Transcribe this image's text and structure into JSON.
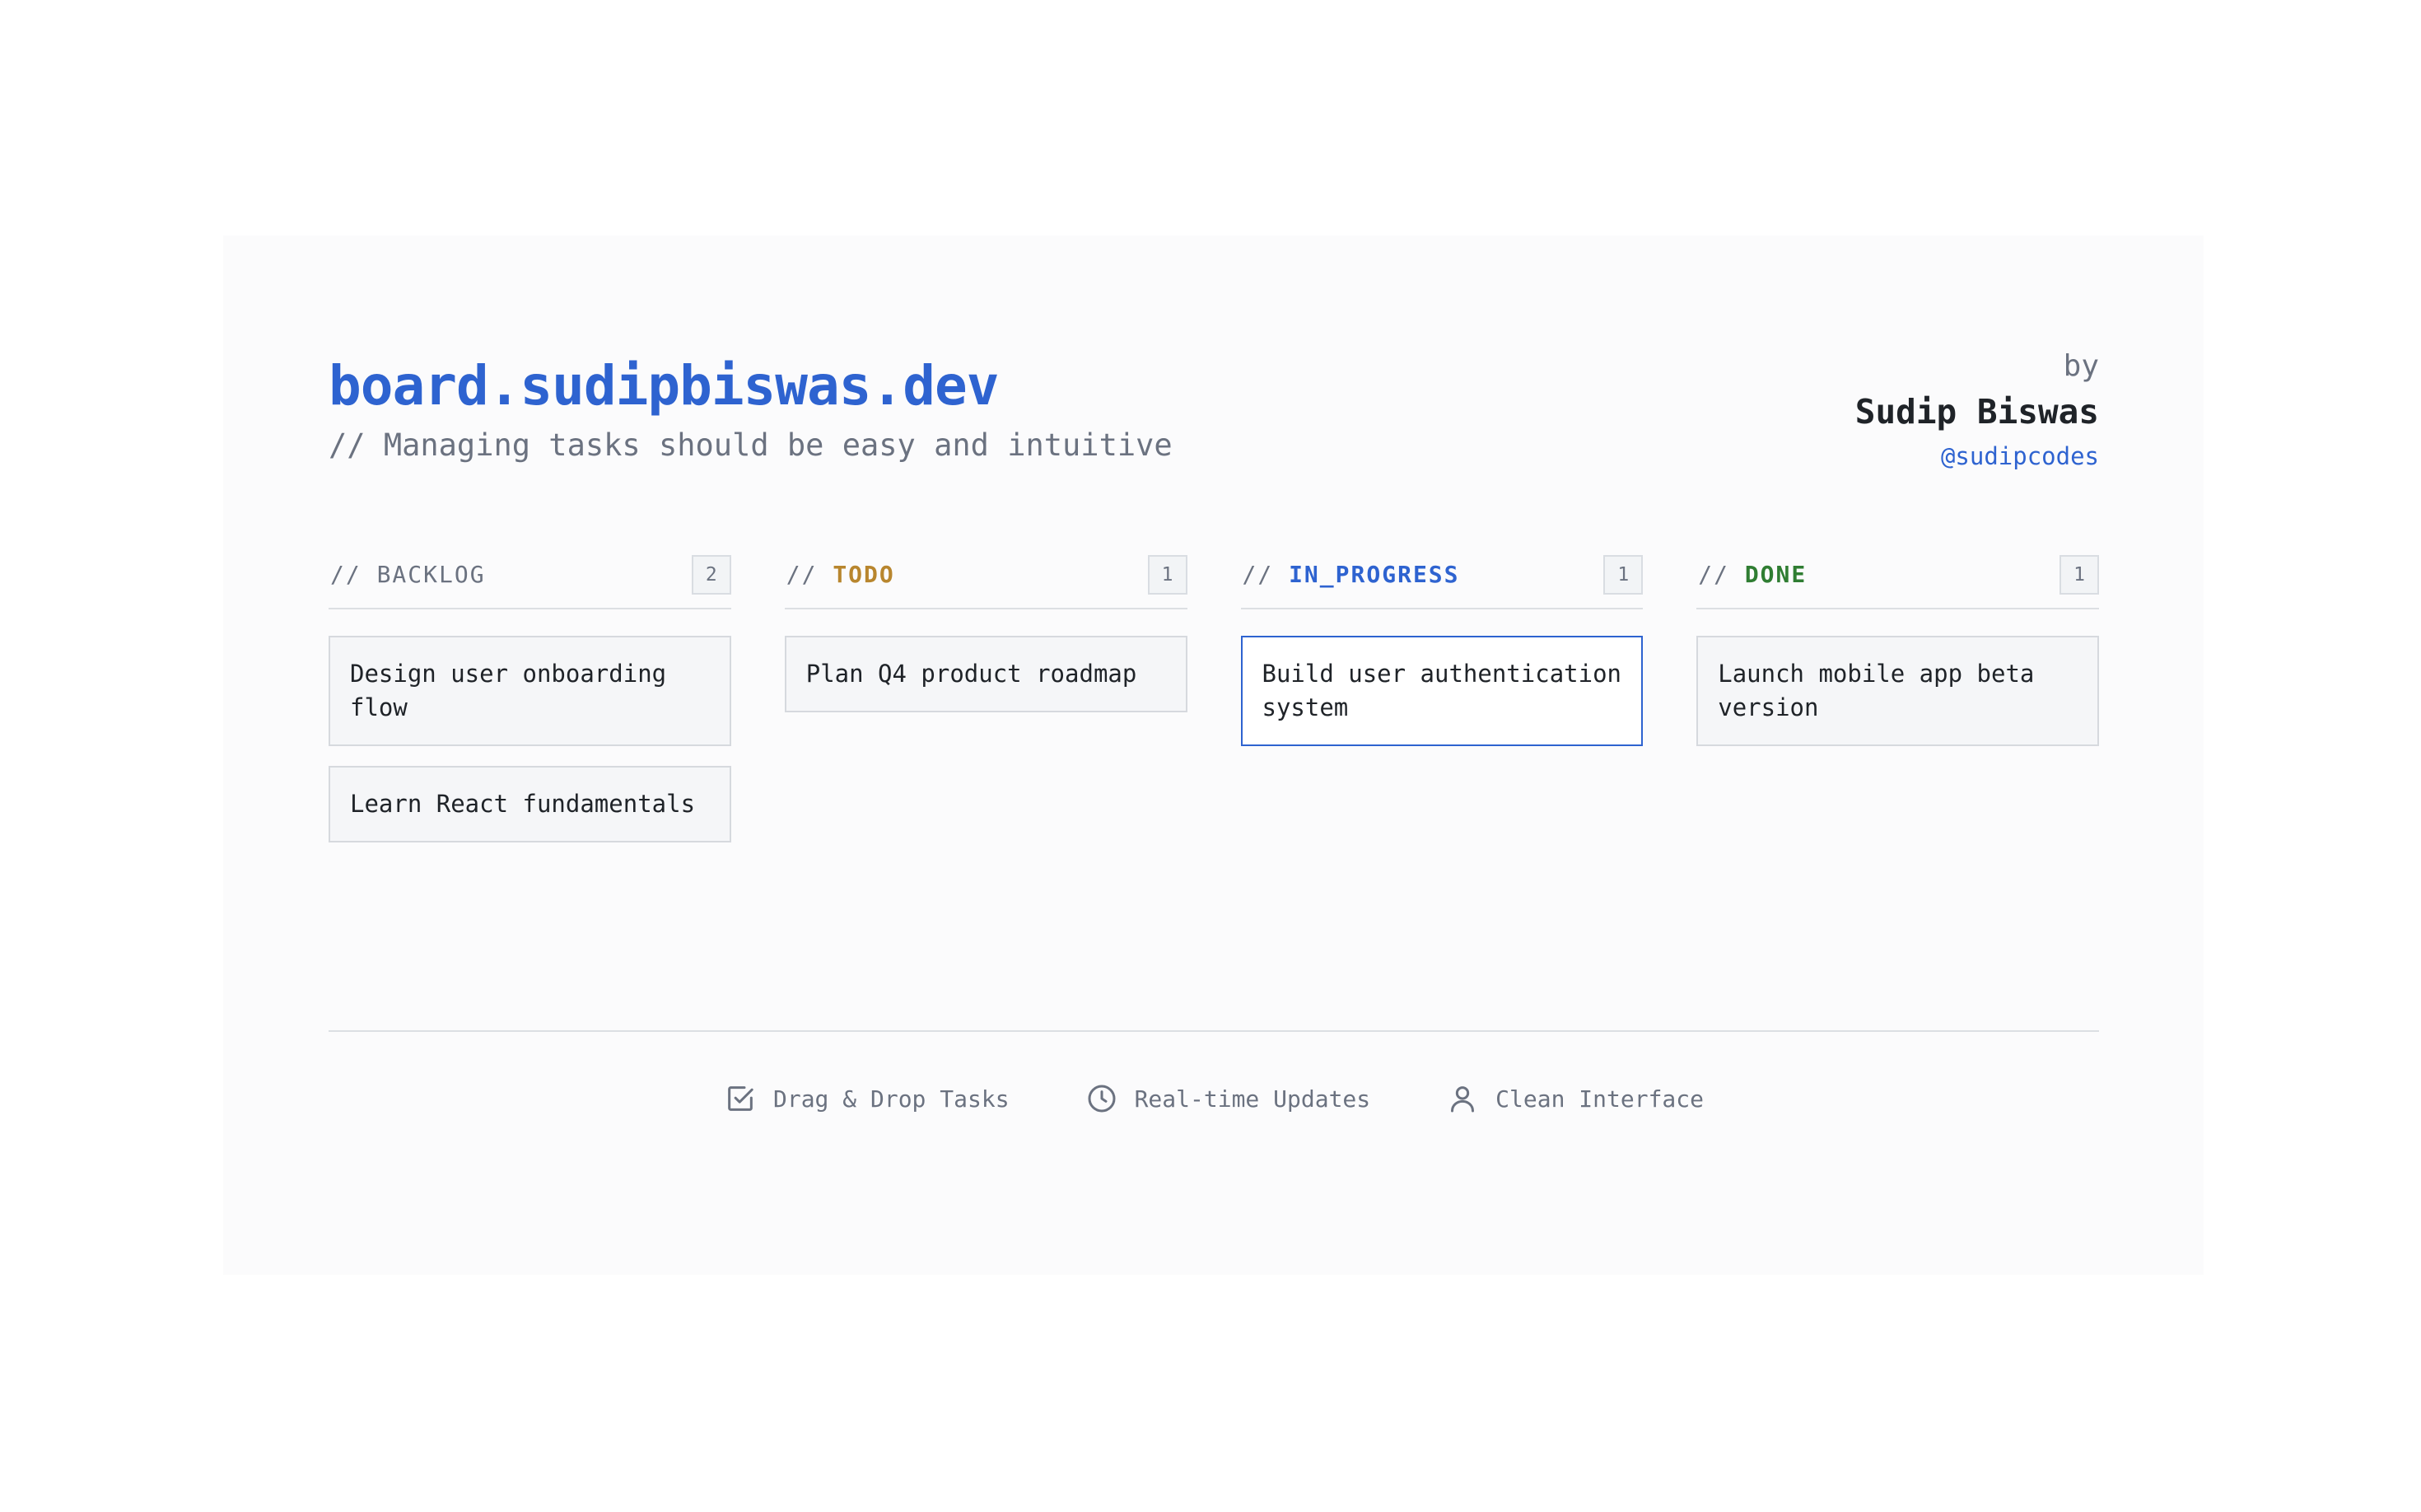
{
  "site": {
    "title": "board.sudipbiswas.dev",
    "tagline": "// Managing tasks should be easy and intuitive"
  },
  "author": {
    "by": "by",
    "name": "Sudip Biswas",
    "handle": "@sudipcodes"
  },
  "colors": {
    "accent": "#2e63d0",
    "backlog": "#6b7280",
    "todo": "#b8862e",
    "in_progress": "#2e63d0",
    "done": "#2f7d32"
  },
  "columns": [
    {
      "prefix": "//",
      "name": "BACKLOG",
      "count": "2",
      "cards": [
        "Design user onboarding flow",
        "Learn React fundamentals"
      ]
    },
    {
      "prefix": "//",
      "name": "TODO",
      "count": "1",
      "cards": [
        "Plan Q4 product roadmap"
      ]
    },
    {
      "prefix": "//",
      "name": "IN_PROGRESS",
      "count": "1",
      "cards": [
        "Build user authentication system"
      ]
    },
    {
      "prefix": "//",
      "name": "DONE",
      "count": "1",
      "cards": [
        "Launch mobile app beta version"
      ]
    }
  ],
  "features": [
    {
      "icon": "checkbox-icon",
      "label": "Drag & Drop Tasks"
    },
    {
      "icon": "clock-icon",
      "label": "Real-time Updates"
    },
    {
      "icon": "user-icon",
      "label": "Clean Interface"
    }
  ]
}
